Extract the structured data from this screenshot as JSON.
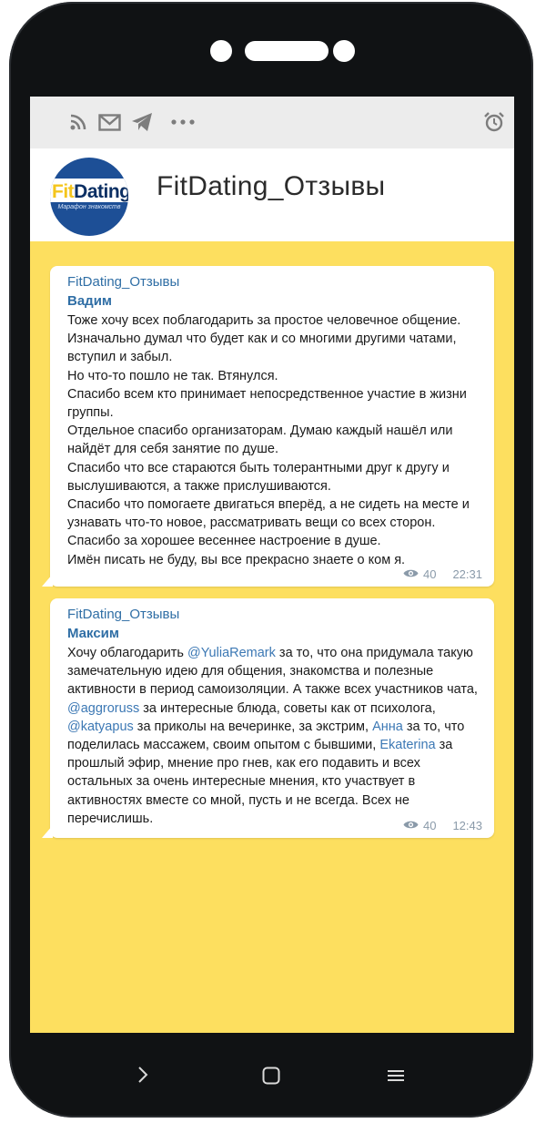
{
  "statusbar": {
    "icons": [
      "rss-icon",
      "mail-icon",
      "telegram-icon",
      "more-icon",
      "alarm-icon"
    ]
  },
  "header": {
    "title": "FitDating_Отзывы",
    "avatar_logo_fit": "Fit",
    "avatar_logo_dating": "Dating",
    "avatar_subtitle": "Марафон знакомств"
  },
  "messages": [
    {
      "sender": "FitDating_Отзывы",
      "author": "Вадим",
      "text_lines": [
        "Тоже хочу всех поблагодарить за простое человечное общение. Изначально думал что будет как и со многими другими чатами, вступил и забыл.",
        "Но что-то пошло не так. Втянулся.",
        "Спасибо всем кто принимает непосредственное участие в жизни группы.",
        "Отдельное спасибо организаторам. Думаю каждый нашёл или найдёт для себя занятие по душе.",
        "Спасибо что все стараются быть толерантными друг к другу и выслушиваются, а также прислушиваются.",
        "Спасибо что помогаете двигаться вперёд, а не сидеть на месте и узнавать что-то новое, рассматривать вещи со всех сторон.",
        "Спасибо за хорошее весеннее настроение в душе.",
        "Имён писать не буду, вы все прекрасно знаете о ком я."
      ],
      "views": "40",
      "time": "22:31"
    },
    {
      "sender": "FitDating_Отзывы",
      "author": "Максим",
      "segments": [
        "Хочу облагодарить ",
        "@YuliaRemark",
        " за то, что она придумала такую замечательную идею для общения, знакомства и полезные активности в период самоизоляции. А также всех участников чата, ",
        "@aggroruss",
        " за интересные блюда, советы как от психолога, ",
        "@katyapus",
        " за приколы на вечеринке, за экстрим, ",
        "Анна",
        " за то, что поделилась массажем, своим опытом с бывшими, ",
        "Ekaterina",
        " за прошлый эфир, мнение про гнев, как его подавить и всех остальных за очень интересные мнения, кто участвует в активностях вместе со мной, пусть и не всегда. Всех не перечислишь."
      ],
      "views": "40",
      "time": "12:43"
    }
  ],
  "navbar": {
    "icons": [
      "back-icon",
      "home-icon",
      "menu-icon"
    ]
  },
  "colors": {
    "chat_background": "#fddf5f",
    "link": "#2f6ea5",
    "phone_body": "#101214"
  }
}
